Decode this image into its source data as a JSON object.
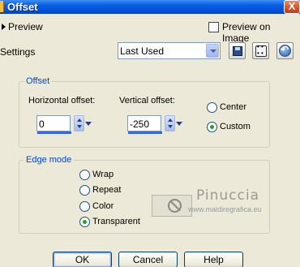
{
  "window": {
    "title": "Offset",
    "close_glyph": "X"
  },
  "preview": {
    "label": "Preview",
    "preview_on_image_label": "Preview on Image",
    "preview_on_image_checked": false
  },
  "settings": {
    "label": "Settings",
    "selected": "Last Used",
    "icons": [
      "save-preset-icon",
      "randomize-dice-icon",
      "reset-icon"
    ]
  },
  "offset_group": {
    "title": "Offset",
    "horizontal": {
      "label": "Horizontal offset:",
      "value": "0"
    },
    "vertical": {
      "label": "Vertical offset:",
      "value": "-250"
    },
    "options": [
      {
        "label": "Center",
        "checked": false
      },
      {
        "label": "Custom",
        "checked": true
      }
    ]
  },
  "edge_mode": {
    "title": "Edge mode",
    "options": [
      {
        "label": "Wrap",
        "checked": false
      },
      {
        "label": "Repeat",
        "checked": false
      },
      {
        "label": "Color",
        "checked": false
      },
      {
        "label": "Transparent",
        "checked": true
      }
    ]
  },
  "watermark": {
    "name": "Pinuccia",
    "url": "www.maidiregrafica.eu"
  },
  "buttons": {
    "ok": "OK",
    "cancel": "Cancel",
    "help": "Help"
  },
  "colors": {
    "titlebar": "#0a5fe0",
    "group_title": "#0046d5",
    "dialog_bg": "#ece9d8",
    "radio_dot": "#21a121"
  }
}
